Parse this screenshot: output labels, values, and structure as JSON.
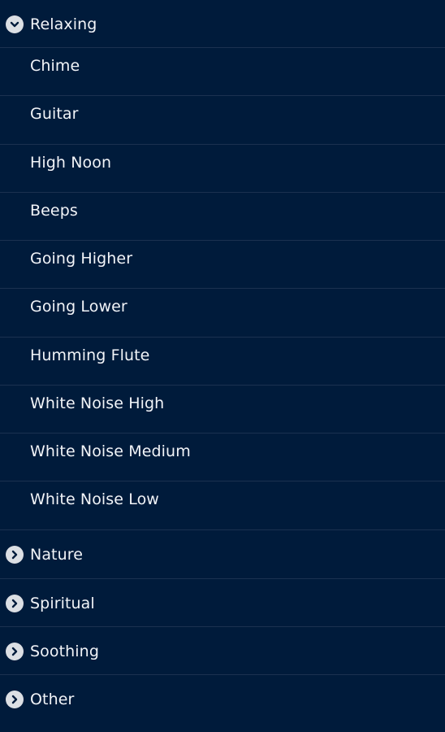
{
  "groups": {
    "relaxing": {
      "label": "Relaxing",
      "expanded": true,
      "icon": "chevron-down-icon",
      "items": [
        "Chime",
        "Guitar",
        "High Noon",
        "Beeps",
        "Going Higher",
        "Going Lower",
        "Humming Flute",
        "White Noise High",
        "White Noise Medium",
        "White Noise Low"
      ]
    },
    "nature": {
      "label": "Nature",
      "expanded": false,
      "icon": "chevron-right-icon"
    },
    "spiritual": {
      "label": "Spiritual",
      "expanded": false,
      "icon": "chevron-right-icon"
    },
    "soothing": {
      "label": "Soothing",
      "expanded": false,
      "icon": "chevron-right-icon"
    },
    "other": {
      "label": "Other",
      "expanded": false,
      "icon": "chevron-right-icon"
    }
  },
  "colors": {
    "background": "#001b3b",
    "divider": "#1b3150",
    "text": "#f2f4f8",
    "icon_circle": "#dcdfe4"
  }
}
